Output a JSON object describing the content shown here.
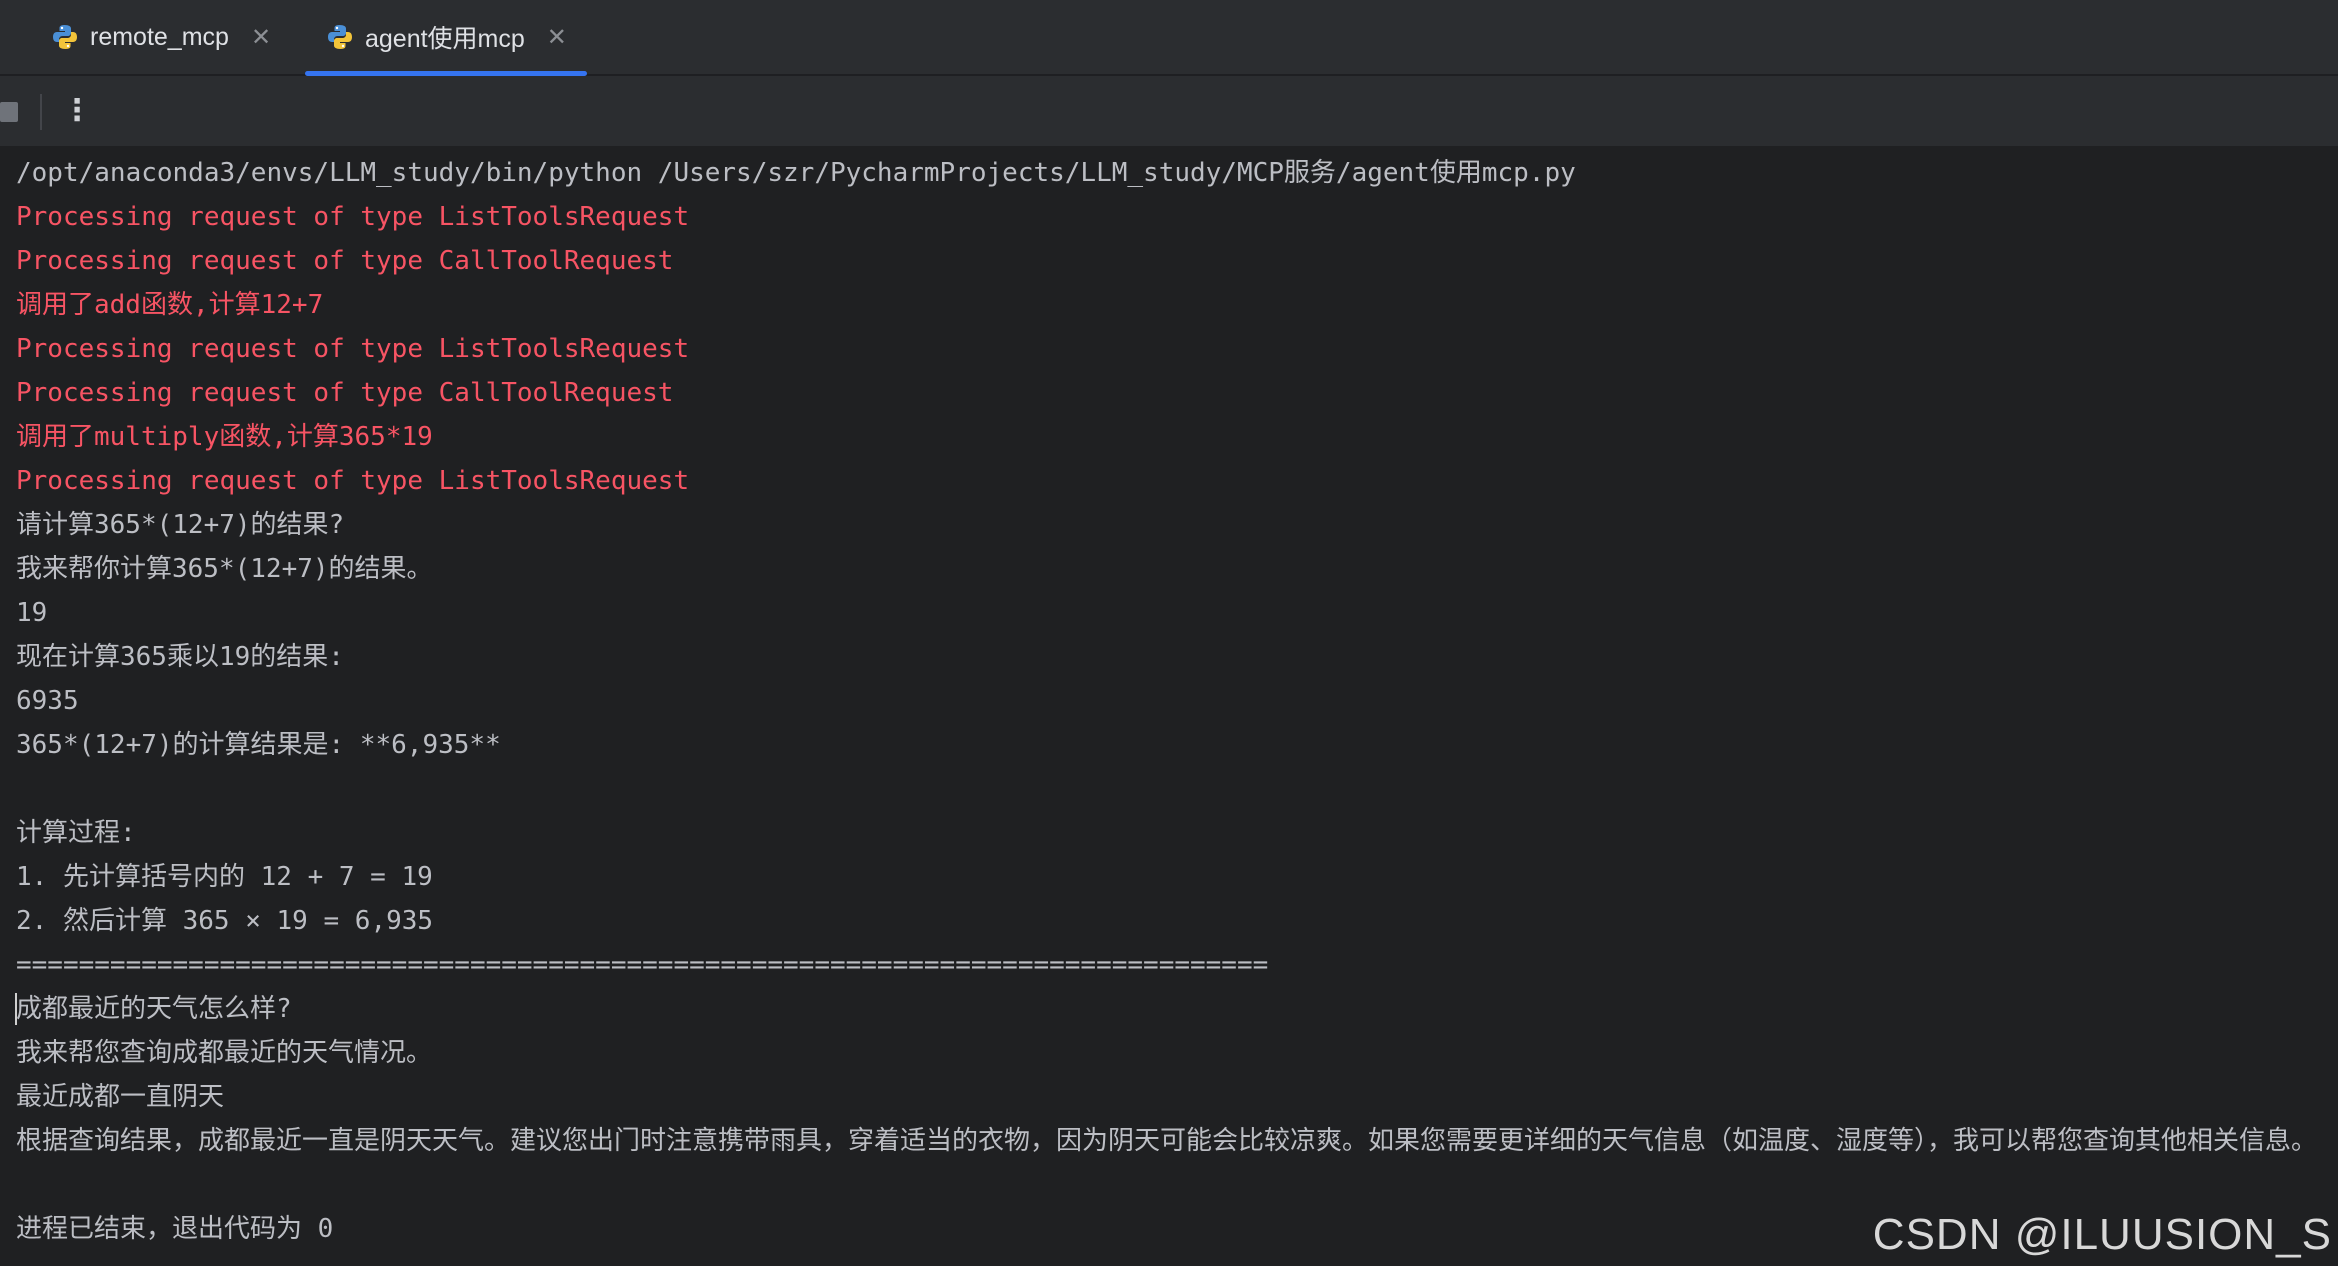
{
  "tabs": [
    {
      "label": "remote_mcp",
      "icon": "python-file-icon",
      "active": false
    },
    {
      "label": "agent使用mcp",
      "icon": "python-file-icon",
      "active": true
    }
  ],
  "toolbar": {
    "stop_icon": "stop-icon",
    "more_icon": "more-vertical-icon"
  },
  "console": {
    "lines": [
      {
        "text": "/opt/anaconda3/envs/LLM_study/bin/python /Users/szr/PycharmProjects/LLM_study/MCP服务/agent使用mcp.py",
        "stream": "stdout"
      },
      {
        "text": "Processing request of type ListToolsRequest",
        "stream": "stderr"
      },
      {
        "text": "Processing request of type CallToolRequest",
        "stream": "stderr"
      },
      {
        "text": "调用了add函数,计算12+7",
        "stream": "stderr"
      },
      {
        "text": "Processing request of type ListToolsRequest",
        "stream": "stderr"
      },
      {
        "text": "Processing request of type CallToolRequest",
        "stream": "stderr"
      },
      {
        "text": "调用了multiply函数,计算365*19",
        "stream": "stderr"
      },
      {
        "text": "Processing request of type ListToolsRequest",
        "stream": "stderr"
      },
      {
        "text": "请计算365*(12+7)的结果?",
        "stream": "stdout"
      },
      {
        "text": "我来帮你计算365*(12+7)的结果。",
        "stream": "stdout"
      },
      {
        "text": "19",
        "stream": "stdout"
      },
      {
        "text": "现在计算365乘以19的结果:",
        "stream": "stdout"
      },
      {
        "text": "6935",
        "stream": "stdout"
      },
      {
        "text": "365*(12+7)的计算结果是: **6,935**",
        "stream": "stdout"
      },
      {
        "text": "",
        "stream": "stdout"
      },
      {
        "text": "计算过程:",
        "stream": "stdout"
      },
      {
        "text": "1. 先计算括号内的 12 + 7 = 19",
        "stream": "stdout"
      },
      {
        "text": "2. 然后计算 365 × 19 = 6,935",
        "stream": "stdout"
      },
      {
        "text": "================================================================================",
        "stream": "stdout"
      },
      {
        "text": "成都最近的天气怎么样?",
        "stream": "stdout"
      },
      {
        "text": "我来帮您查询成都最近的天气情况。",
        "stream": "stdout"
      },
      {
        "text": "最近成都一直阴天",
        "stream": "stdout"
      },
      {
        "text": "根据查询结果，成都最近一直是阴天天气。建议您出门时注意携带雨具，穿着适当的衣物，因为阴天可能会比较凉爽。如果您需要更详细的天气信息（如温度、湿度等），我可以帮您查询其他相关信息。",
        "stream": "stdout"
      },
      {
        "text": "",
        "stream": "stdout"
      },
      {
        "text": "进程已结束，退出代码为 0",
        "stream": "stdout"
      }
    ]
  },
  "watermark": "CSDN @ILUUSION_S",
  "colors": {
    "stderr": "#f75464",
    "stdout": "#bcbec4",
    "tab_underline": "#3574f0",
    "background": "#1f2022"
  }
}
